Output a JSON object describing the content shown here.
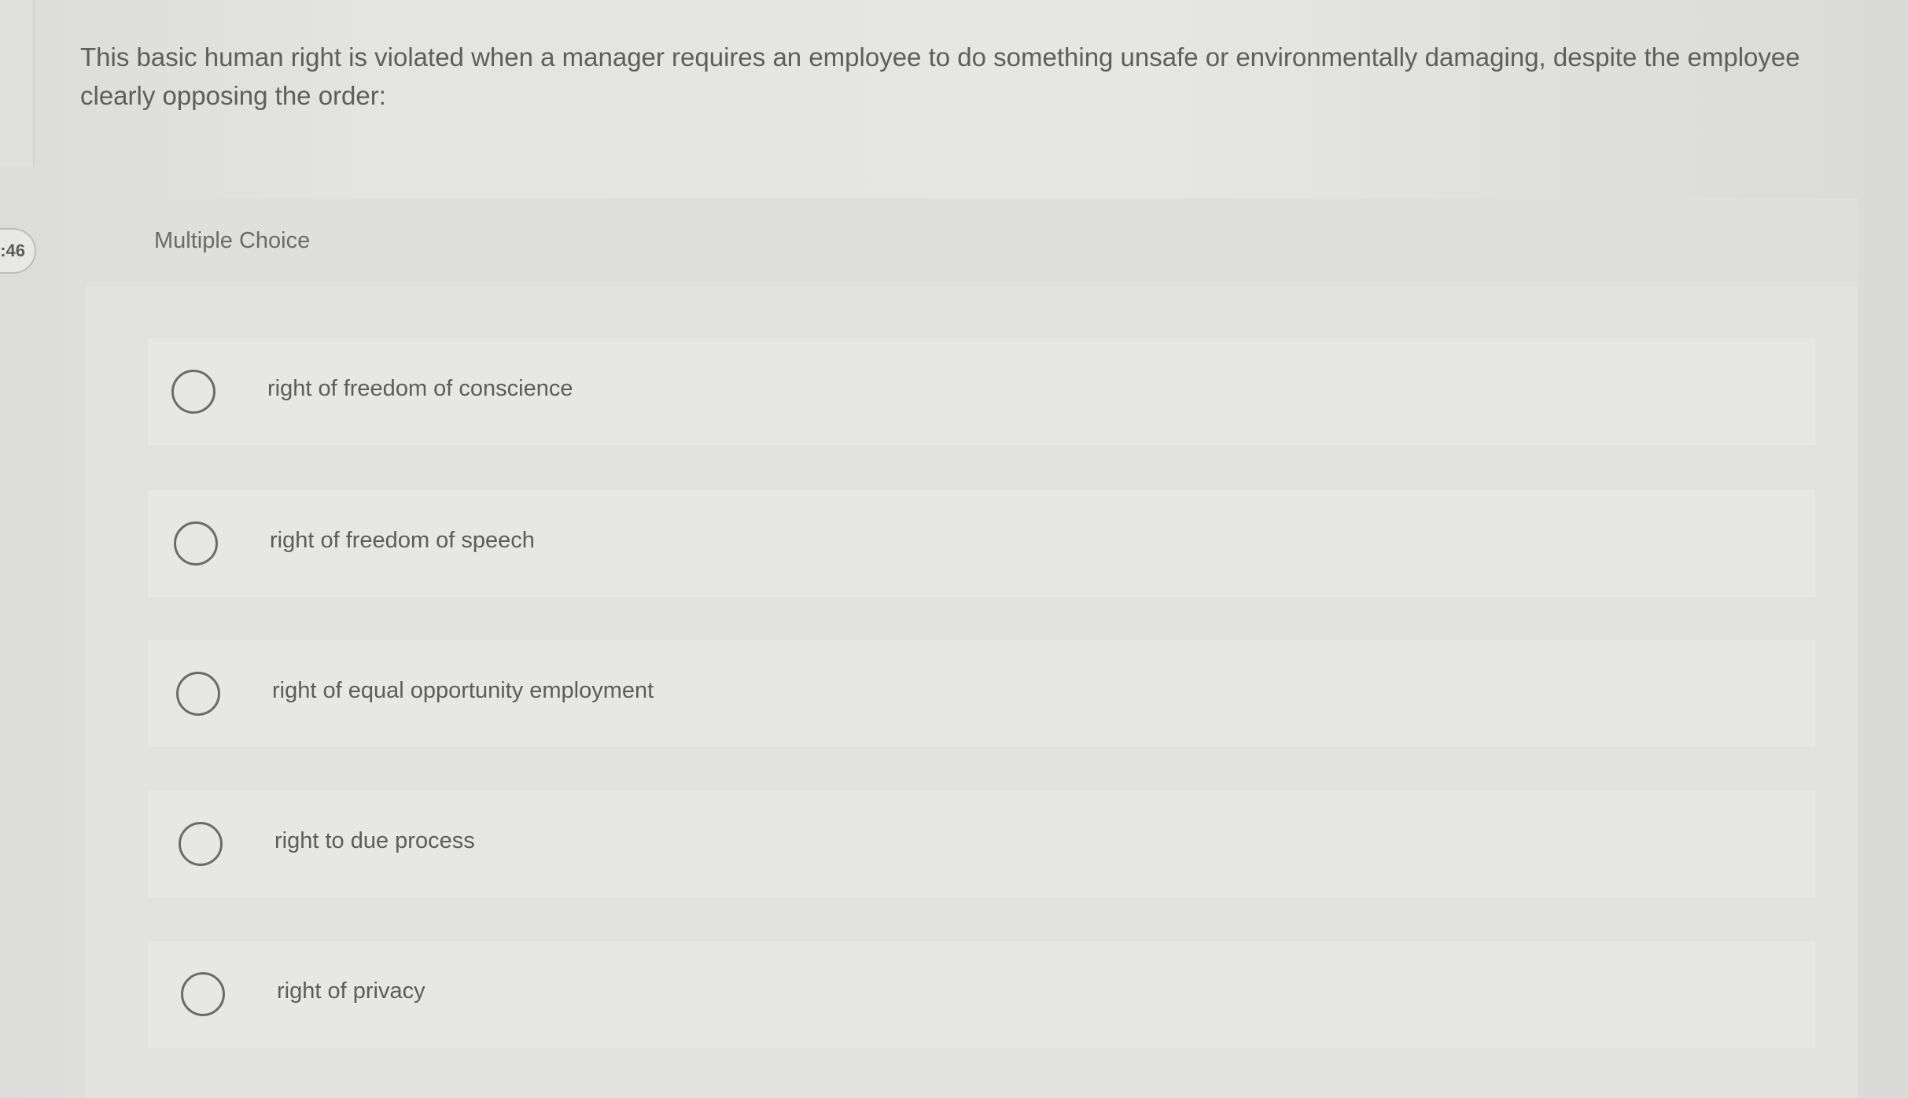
{
  "timer": {
    "text": ":46"
  },
  "question": {
    "text": "This basic human right is violated when a manager requires an employee to do something unsafe or environmentally damaging, despite the employee clearly opposing the order:"
  },
  "card": {
    "type_label": "Multiple Choice",
    "options": [
      {
        "label": "right of freedom of conscience",
        "selected": false
      },
      {
        "label": "right of freedom of speech",
        "selected": false
      },
      {
        "label": "right of equal opportunity employment",
        "selected": false
      },
      {
        "label": "right to due process",
        "selected": false
      },
      {
        "label": "right of privacy",
        "selected": false
      }
    ]
  },
  "colors": {
    "background": "#e4e4e1",
    "card_background": "#e2e2df",
    "option_background": "#e7e7e4",
    "text": "#5e5e5e",
    "radio_border": "#6b6b6b"
  }
}
